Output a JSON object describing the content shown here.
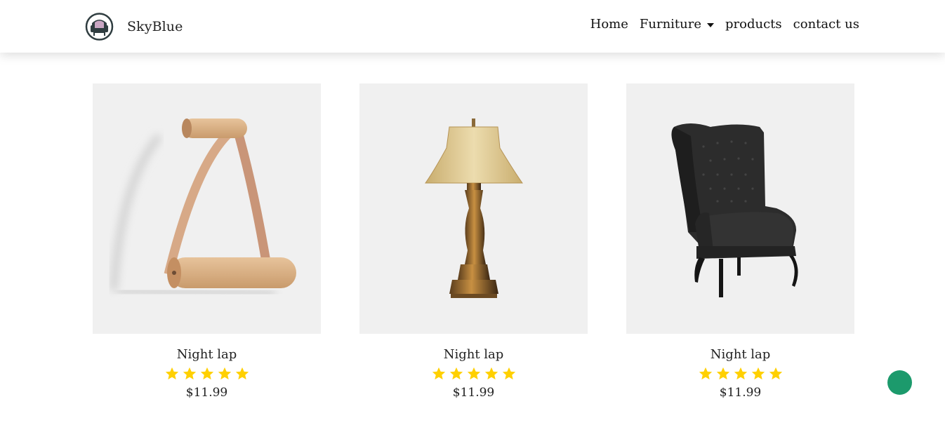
{
  "brand": {
    "name": "SkyBlue",
    "logo_icon": "armchair-logo-icon"
  },
  "nav": {
    "home": "Home",
    "furniture": "Furniture",
    "products": "products",
    "contact": "contact us"
  },
  "products": [
    {
      "image_icon": "towel-holder-image",
      "title": "Night lap",
      "rating": 5,
      "price": "$11.99"
    },
    {
      "image_icon": "table-lamp-image",
      "title": "Night lap",
      "rating": 5,
      "price": "$11.99"
    },
    {
      "image_icon": "armchair-image",
      "title": "Night lap",
      "rating": 5,
      "price": "$11.99"
    }
  ],
  "colors": {
    "star": "#ffd000",
    "fab": "#1c9a6c",
    "card_bg": "#f0f0f0"
  }
}
